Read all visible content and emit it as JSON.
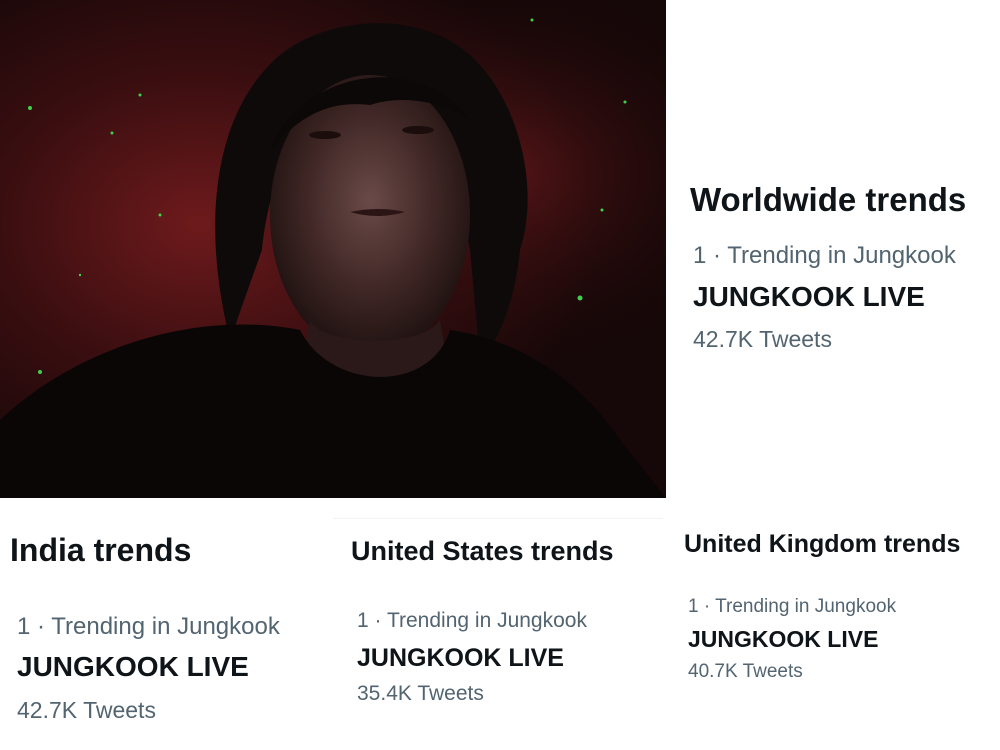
{
  "photo": {
    "description_icon": "person-video-icon"
  },
  "panels": {
    "worldwide": {
      "title": "Worldwide trends",
      "meta": "1 · Trending in Jungkook",
      "name": "JUNGKOOK LIVE",
      "count": "42.7K Tweets"
    },
    "india": {
      "title": "India trends",
      "meta": "1 · Trending in Jungkook",
      "name": "JUNGKOOK LIVE",
      "count": "42.7K Tweets"
    },
    "united_states": {
      "title": "United States trends",
      "meta": "1 · Trending in Jungkook",
      "name": "JUNGKOOK LIVE",
      "count": "35.4K Tweets"
    },
    "united_kingdom": {
      "title": "United Kingdom trends",
      "meta": "1 · Trending in Jungkook",
      "name": "JUNGKOOK LIVE",
      "count": "40.7K Tweets"
    }
  },
  "colors": {
    "text_primary": "#0f1419",
    "text_secondary": "#536471"
  }
}
